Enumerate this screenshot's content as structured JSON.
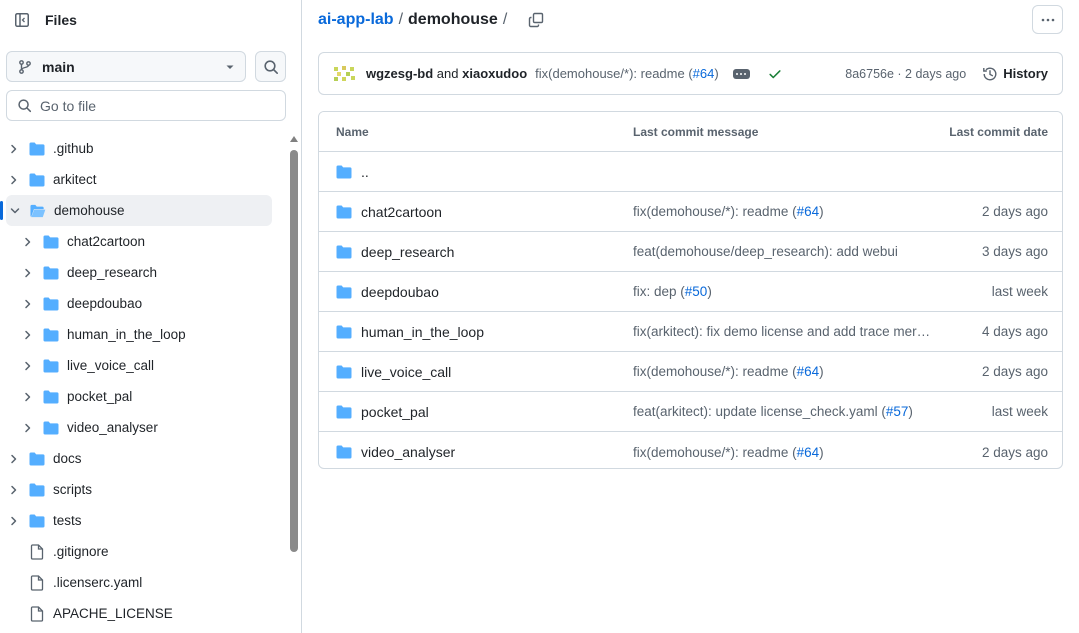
{
  "sidebar": {
    "title": "Files",
    "branch": "main",
    "goto_placeholder": "Go to file",
    "tree": [
      {
        "label": ".github",
        "type": "folder",
        "depth": 0,
        "expanded": false
      },
      {
        "label": "arkitect",
        "type": "folder",
        "depth": 0,
        "expanded": false
      },
      {
        "label": "demohouse",
        "type": "folder",
        "depth": 0,
        "expanded": true,
        "selected": true
      },
      {
        "label": "chat2cartoon",
        "type": "folder",
        "depth": 1,
        "expanded": false
      },
      {
        "label": "deep_research",
        "type": "folder",
        "depth": 1,
        "expanded": false
      },
      {
        "label": "deepdoubao",
        "type": "folder",
        "depth": 1,
        "expanded": false
      },
      {
        "label": "human_in_the_loop",
        "type": "folder",
        "depth": 1,
        "expanded": false
      },
      {
        "label": "live_voice_call",
        "type": "folder",
        "depth": 1,
        "expanded": false
      },
      {
        "label": "pocket_pal",
        "type": "folder",
        "depth": 1,
        "expanded": false
      },
      {
        "label": "video_analyser",
        "type": "folder",
        "depth": 1,
        "expanded": false
      },
      {
        "label": "docs",
        "type": "folder",
        "depth": 0,
        "expanded": false
      },
      {
        "label": "scripts",
        "type": "folder",
        "depth": 0,
        "expanded": false
      },
      {
        "label": "tests",
        "type": "folder",
        "depth": 0,
        "expanded": false
      },
      {
        "label": ".gitignore",
        "type": "file",
        "depth": 0
      },
      {
        "label": ".licenserc.yaml",
        "type": "file",
        "depth": 0
      },
      {
        "label": "APACHE_LICENSE",
        "type": "file",
        "depth": 0
      }
    ]
  },
  "breadcrumb": {
    "repo": "ai-app-lab",
    "sep": "/",
    "current": "demohouse",
    "trail": "/"
  },
  "commit": {
    "author1": "wgzesg-bd",
    "and": "and",
    "author2": "xiaoxudoo",
    "message": "fix(demohouse/*): readme (",
    "pr": "#64",
    "close": ")",
    "sha_time": "8a6756e · 2 days ago",
    "history": "History"
  },
  "table": {
    "headers": {
      "name": "Name",
      "message": "Last commit message",
      "date": "Last commit date"
    },
    "parent": "..",
    "rows": [
      {
        "name": "chat2cartoon",
        "msg": "fix(demohouse/*): readme (",
        "pr": "#64",
        "end": ")",
        "date": "2 days ago"
      },
      {
        "name": "deep_research",
        "msg": "feat(demohouse/deep_research): add webui",
        "pr": "",
        "end": "",
        "date": "3 days ago"
      },
      {
        "name": "deepdoubao",
        "msg": "fix: dep (",
        "pr": "#50",
        "end": ")",
        "date": "last week"
      },
      {
        "name": "human_in_the_loop",
        "msg": "fix(arkitect): fix demo license and add trace mer…",
        "pr": "",
        "end": "",
        "date": "4 days ago"
      },
      {
        "name": "live_voice_call",
        "msg": "fix(demohouse/*): readme (",
        "pr": "#64",
        "end": ")",
        "date": "2 days ago"
      },
      {
        "name": "pocket_pal",
        "msg": "feat(arkitect): update license_check.yaml (",
        "pr": "#57",
        "end": ")",
        "date": "last week"
      },
      {
        "name": "video_analyser",
        "msg": "fix(demohouse/*): readme (",
        "pr": "#64",
        "end": ")",
        "date": "2 days ago"
      }
    ]
  },
  "colors": {
    "accent": "#0969da",
    "folder": "#54aeff",
    "success": "#1a7f37"
  }
}
